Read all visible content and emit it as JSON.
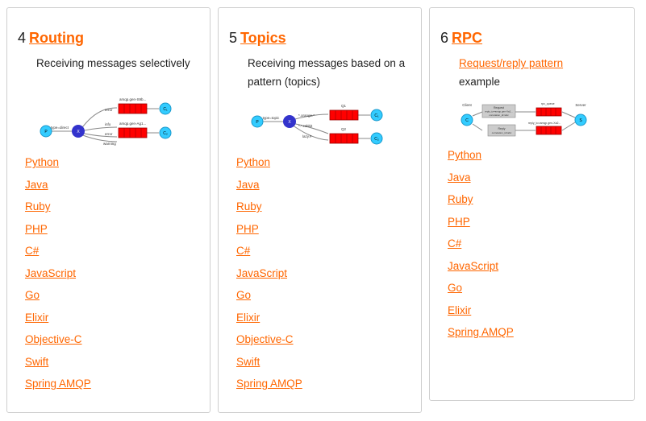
{
  "cards": [
    {
      "number": "4",
      "title": "Routing",
      "description": "Receiving messages selectively",
      "diagram": {
        "producer": "P",
        "exchange": "X",
        "consumers": [
          "C₁",
          "C₂"
        ],
        "queues": [
          "amqp.gen-S9b...",
          "amqp.gen-Ag1..."
        ],
        "bindings": [
          "type=direct",
          "error",
          "info",
          "error",
          "warning"
        ]
      },
      "links": [
        "Python",
        "Java",
        "Ruby",
        "PHP",
        "C#",
        "JavaScript",
        "Go",
        "Elixir",
        "Objective-C",
        "Swift",
        "Spring AMQP"
      ]
    },
    {
      "number": "5",
      "title": "Topics",
      "description": "Receiving messages based on a pattern (topics)",
      "diagram": {
        "producer": "P",
        "exchange": "X",
        "consumers": [
          "C₁",
          "C₂"
        ],
        "queues": [
          "Q1",
          "Q2"
        ],
        "bindings": [
          "type=topic",
          "*.orange.*",
          "*.*.rabbit",
          "lazy.#"
        ]
      },
      "links": [
        "Python",
        "Java",
        "Ruby",
        "PHP",
        "C#",
        "JavaScript",
        "Go",
        "Elixir",
        "Objective-C",
        "Swift",
        "Spring AMQP"
      ]
    },
    {
      "number": "6",
      "title": "RPC",
      "description_link": "Request/reply pattern",
      "description_rest": "example",
      "diagram": {
        "client": "Client",
        "server": "Server",
        "node_client": "C",
        "node_server": "S",
        "queues": [
          "rpc_queue",
          "reply_to=amqp.gen-Xa2..."
        ],
        "request_box": [
          "Request",
          "reply_to=amqp.gen-Xa2...",
          "correlation_id=abc"
        ],
        "reply_box": [
          "Reply",
          "correlation_id=abc"
        ]
      },
      "links": [
        "Python",
        "Java",
        "Ruby",
        "PHP",
        "C#",
        "JavaScript",
        "Go",
        "Elixir",
        "Spring AMQP"
      ]
    }
  ],
  "colors": {
    "link": "#ff6600",
    "node": "#33ccff",
    "exchange": "#3333cc",
    "queue": "#ff0000"
  }
}
